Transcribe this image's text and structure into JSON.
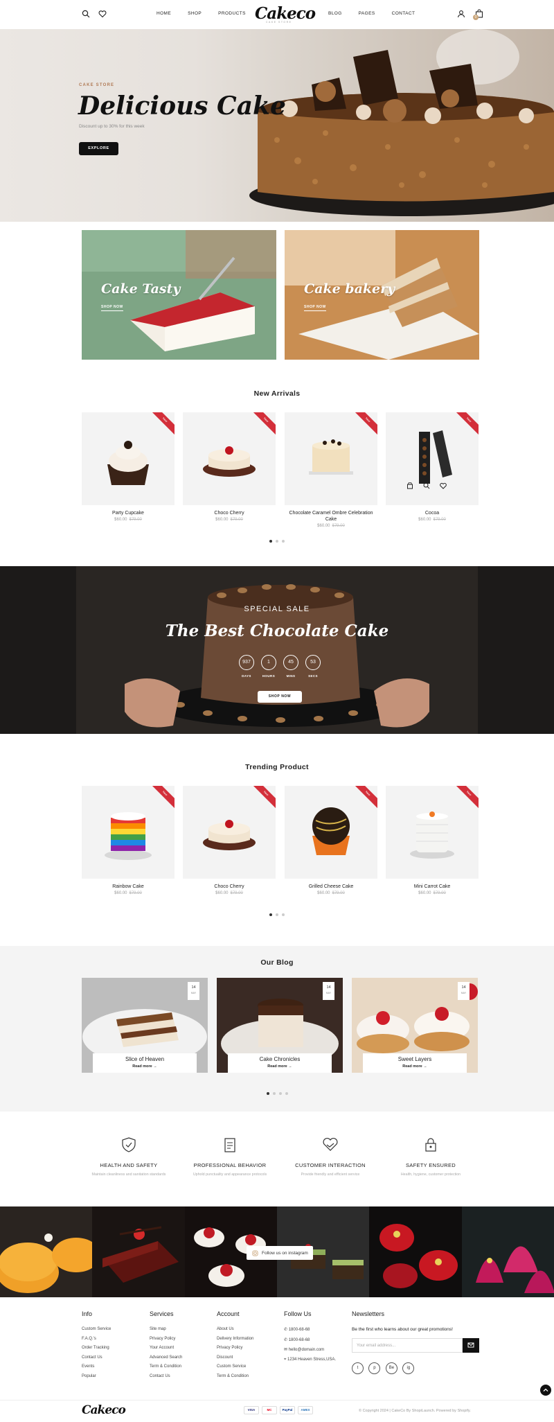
{
  "header": {
    "logo": "Cakeco",
    "logo_sub": "CAKE STORE",
    "nav_left": [
      "HOME",
      "SHOP",
      "PRODUCTS"
    ],
    "nav_right": [
      "BLOG",
      "PAGES",
      "CONTACT"
    ],
    "cart_count": "0"
  },
  "hero": {
    "eyebrow": "CAKE STORE",
    "title": "Delicious Cake",
    "subtitle": "Discount up to 30% for this week",
    "button": "EXPLORE"
  },
  "promos": [
    {
      "title": "Cake Tasty",
      "link": "SHOP NOW"
    },
    {
      "title": "Cake bakery",
      "link": "SHOP NOW"
    }
  ],
  "new_arrivals": {
    "title": "New Arrivals",
    "ribbon": "New",
    "products": [
      {
        "name": "Party Cupcake",
        "price": "$60.00",
        "old_price": "$79.00"
      },
      {
        "name": "Choco Cherry",
        "price": "$60.00",
        "old_price": "$79.00"
      },
      {
        "name": "Chocolate Caramel Ombre Celebration Cake",
        "price": "$60.00",
        "old_price": "$79.00"
      },
      {
        "name": "Cocoa",
        "price": "$60.00",
        "old_price": "$79.00"
      }
    ]
  },
  "sale": {
    "eyebrow": "SPECIAL SALE",
    "title": "The Best Chocolate Cake",
    "countdown": [
      {
        "value": "937",
        "label": "DAYS"
      },
      {
        "value": "1",
        "label": "HOURS"
      },
      {
        "value": "45",
        "label": "MINS"
      },
      {
        "value": "53",
        "label": "SECS"
      }
    ],
    "button": "SHOP NOW"
  },
  "trending": {
    "title": "Trending Product",
    "ribbon": "New",
    "products": [
      {
        "name": "Rainbow Cake",
        "price": "$60.00",
        "old_price": "$79.00"
      },
      {
        "name": "Choco Cherry",
        "price": "$60.00",
        "old_price": "$79.00"
      },
      {
        "name": "Grilled Cheese Cake",
        "price": "$60.00",
        "old_price": "$79.00"
      },
      {
        "name": "Mini Carrot Cake",
        "price": "$60.00",
        "old_price": "$79.00"
      }
    ]
  },
  "blog": {
    "title": "Our Blog",
    "posts": [
      {
        "title": "Slice of Heaven",
        "link": "Read more",
        "day": "14",
        "month": "MAY"
      },
      {
        "title": "Cake Chronicles",
        "link": "Read more",
        "day": "14",
        "month": "MAY"
      },
      {
        "title": "Sweet Layers",
        "link": "Read more",
        "day": "14",
        "month": "MAY"
      }
    ]
  },
  "features": [
    {
      "title": "HEALTH AND SAFETY",
      "desc": "Maintain cleanliness and sanitation standards",
      "icon": "shield-check-icon"
    },
    {
      "title": "PROFESSIONAL BEHAVIOR",
      "desc": "Uphold punctuality and appearance protocols",
      "icon": "clipboard-icon"
    },
    {
      "title": "CUSTOMER INTERACTION",
      "desc": "Provide friendly and efficient service",
      "icon": "handshake-heart-icon"
    },
    {
      "title": "SAFETY ENSURED",
      "desc": "Health, hygiene, customer protection",
      "icon": "lock-icon"
    }
  ],
  "instagram": {
    "label": "Follow us on instagram"
  },
  "footer": {
    "info": {
      "title": "Info",
      "items": [
        "Custom Service",
        "F.A.Q.'s",
        "Order Tracking",
        "Contact Us",
        "Events",
        "Popular"
      ]
    },
    "services": {
      "title": "Services",
      "items": [
        "Site map",
        "Privacy Policy",
        "Your Account",
        "Advanced Search",
        "Term & Condition",
        "Contact Us"
      ]
    },
    "account": {
      "title": "Account",
      "items": [
        "About Us",
        "Delivery Information",
        "Privacy Policy",
        "Discount",
        "Custom Service",
        "Term & Condition"
      ]
    },
    "follow": {
      "title": "Follow Us",
      "items": [
        "1800-68-68",
        "1800-68-68",
        "hello@domain.com",
        "1234 Heaven Stress,USA."
      ]
    },
    "newsletter": {
      "title": "Newsletters",
      "text": "Be the first who learns about our great promotions!",
      "placeholder": "Your email address..."
    },
    "social": [
      "t",
      "p",
      "Be",
      "ig"
    ],
    "logo": "Cakeco",
    "payments": [
      "VISA",
      "MC",
      "PayPal",
      "AMEX"
    ],
    "copyright": "© Copyright 2024 | CakeCo By ShopiLaunch. Powered by Shopify."
  }
}
